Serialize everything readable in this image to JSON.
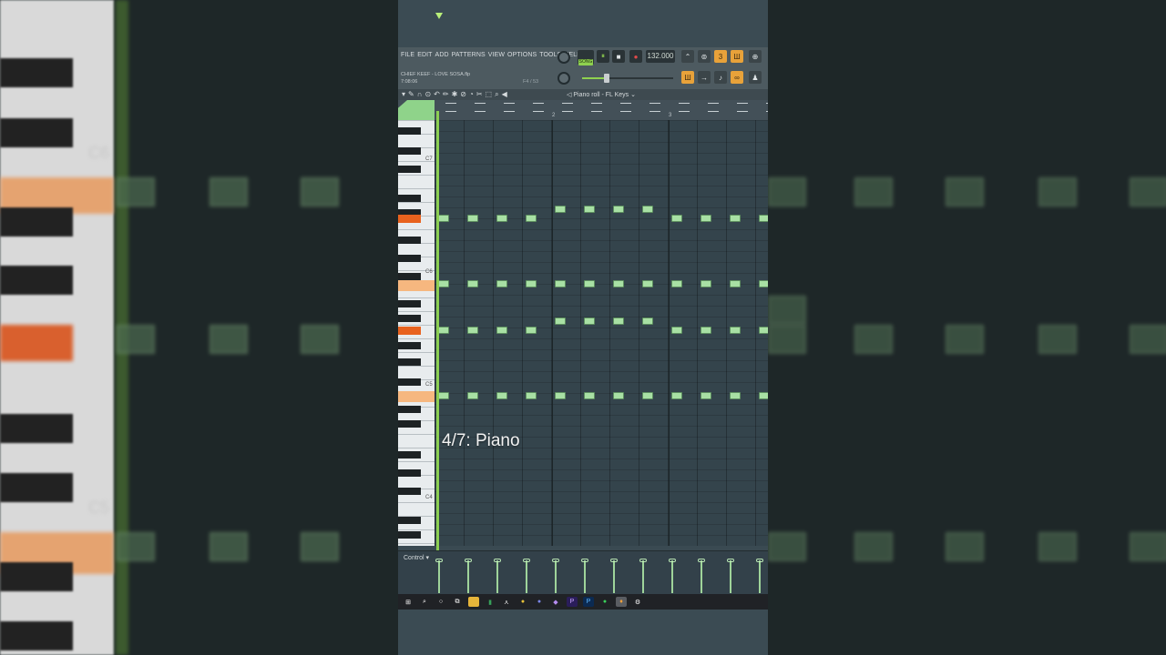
{
  "menu": [
    "FILE",
    "EDIT",
    "ADD",
    "PATTERNS",
    "VIEW",
    "OPTIONS",
    "TOOLS",
    "HELP"
  ],
  "song": {
    "filename": "CHIEF KEEF - LOVE SOSA.flp",
    "time": "7:08:06",
    "position": "F4 / 53"
  },
  "transport": {
    "song_mode": "SONG",
    "tempo": "132.000"
  },
  "piano_roll": {
    "title": "Piano roll - FL Keys"
  },
  "ruler": {
    "bar2": "2",
    "bar3": "3"
  },
  "keyboard": {
    "c7": "C7",
    "c6": "C6",
    "c5": "C5",
    "c4": "C4"
  },
  "overlay": {
    "caption": "4/7: Piano"
  },
  "control": {
    "label": "Control"
  },
  "background": {
    "c6": "C6",
    "c5": "C5"
  },
  "colors": {
    "accent": "#8fd14f",
    "note": "#a8e0a4",
    "key_highlight": "#f6b77f",
    "key_active": "#e8621e",
    "grid": "#34444c"
  },
  "icons": [
    "windows-icon",
    "search-icon",
    "cortana-icon",
    "task-view-icon",
    "explorer-icon",
    "excel-icon",
    "acrobat-icon",
    "chrome-icon",
    "discord-icon",
    "app-icon",
    "premiere-icon",
    "photoshop-icon",
    "spotify-icon",
    "fl-studio-icon",
    "settings-icon"
  ]
}
